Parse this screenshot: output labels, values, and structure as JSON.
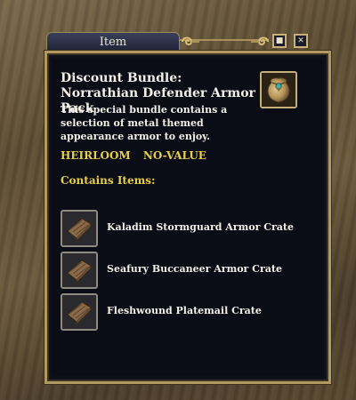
{
  "window": {
    "title": "Item",
    "controls": {
      "minimize_icon": "square-icon",
      "close_icon": "x-icon",
      "close_glyph": "✕",
      "minimize_glyph": "■"
    }
  },
  "item": {
    "name": "Discount Bundle: Norrathian Defender Armor Pack",
    "description": "This special bundle contains a selection of metal themed appearance armor to enjoy.",
    "icon": "bundle-bag-icon",
    "flags": [
      "HEIRLOOM",
      "NO-VALUE"
    ]
  },
  "contents": {
    "heading": "Contains Items:",
    "items": [
      {
        "label": "Kaladim Stormguard Armor Crate",
        "icon": "crate-icon"
      },
      {
        "label": "Seafury Buccaneer Armor Crate",
        "icon": "crate-icon"
      },
      {
        "label": "Fleshwound Platemail Crate",
        "icon": "crate-icon"
      }
    ]
  },
  "colors": {
    "text_primary": "#f2efe6",
    "text_highlight": "#e7cf49",
    "frame_gold": "#b09a62",
    "panel_bg": "#0a0c16"
  }
}
